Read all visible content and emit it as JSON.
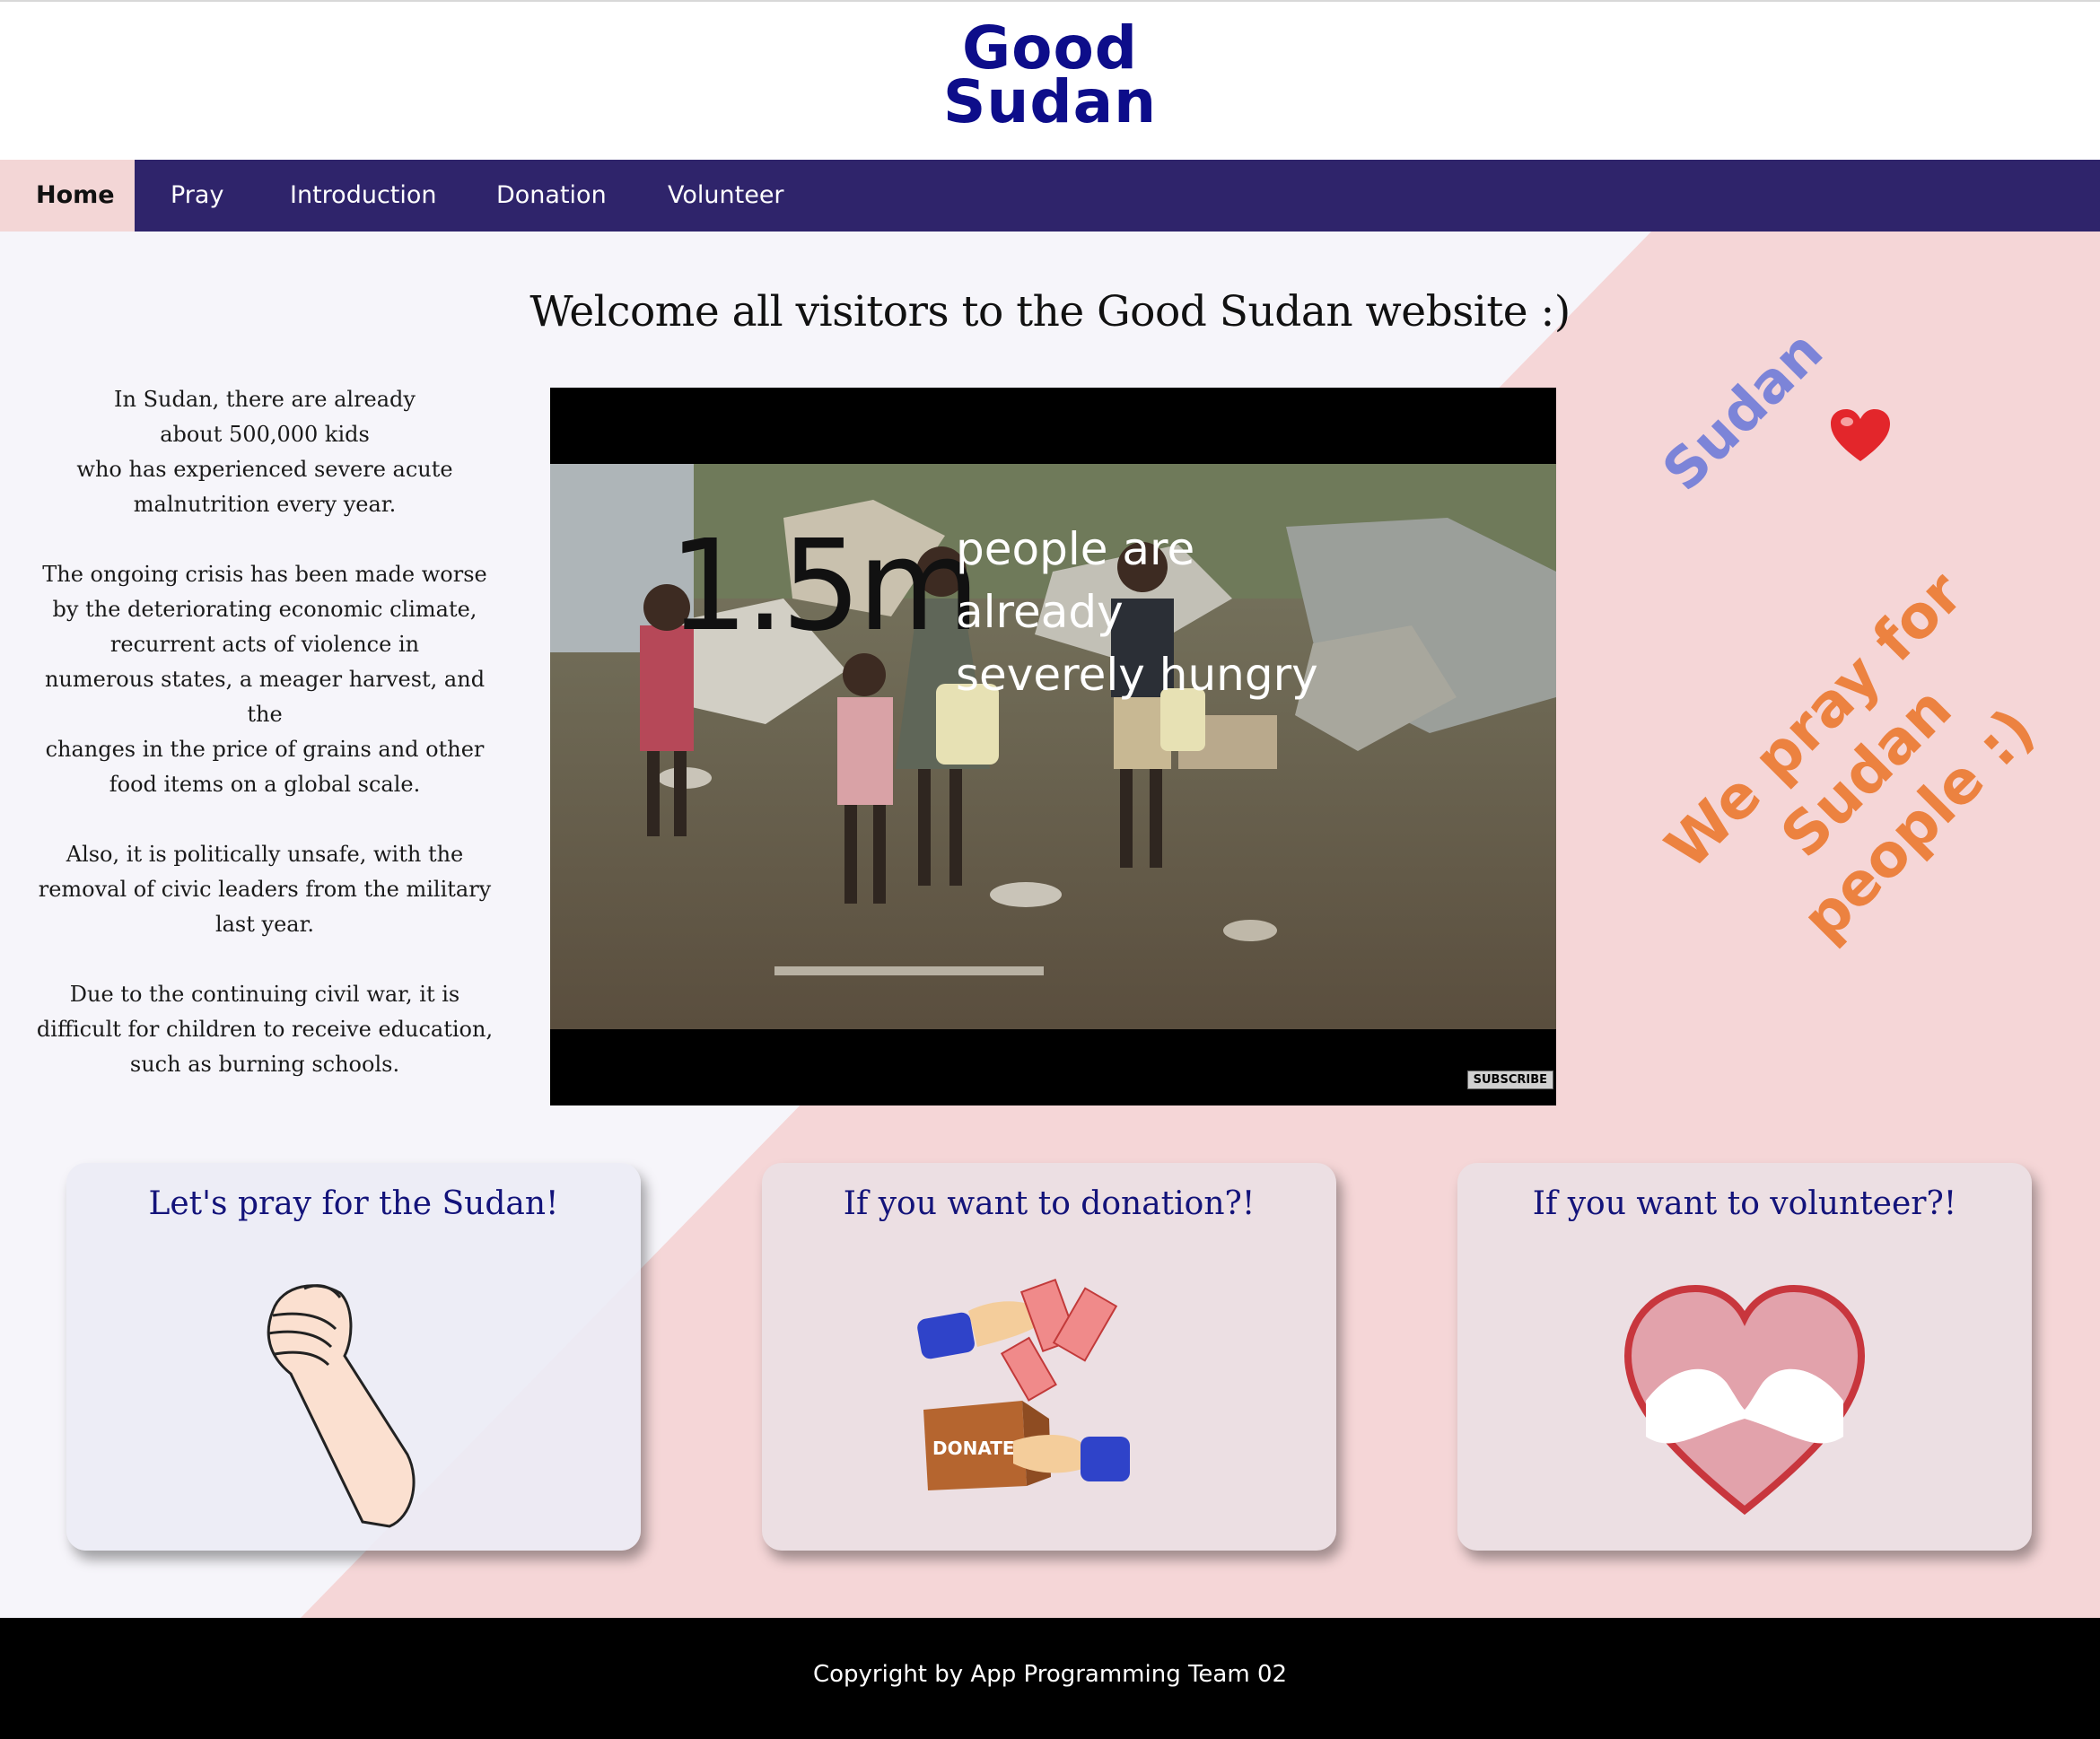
{
  "brand": {
    "logo_line1": "Good",
    "logo_line2": "Sudan"
  },
  "nav": {
    "items": [
      {
        "label": "Home",
        "active": true
      },
      {
        "label": "Pray"
      },
      {
        "label": "Introduction"
      },
      {
        "label": "Donation"
      },
      {
        "label": "Volunteer"
      }
    ]
  },
  "main": {
    "welcome": "Welcome all visitors to the Good Sudan website :)",
    "facts": [
      "In Sudan, there are already\nabout 500,000 kids\nwho has experienced severe acute\nmalnutrition every year.",
      "The ongoing crisis has been made worse\nby the deteriorating economic climate,\nrecurrent acts of violence in\nnumerous states, a meager harvest, and the\nchanges in the price of grains and other\nfood items on a global scale.",
      "Also, it is politically unsafe, with the\nremoval of civic leaders from the military\nlast year.",
      "Due to the continuing civil war, it is\ndifficult for children to receive education,\nsuch as burning schools."
    ],
    "video": {
      "big_number": "1.5m",
      "caption": "people are already\nseverely hungry",
      "subscribe": "SUBSCRIBE"
    },
    "slogan_top": "Sudan",
    "slogan_bottom": "We pray for\nSudan people :)"
  },
  "cards": [
    {
      "title": "Let's pray for the Sudan!",
      "icon": "praying-hands-icon"
    },
    {
      "title": "If you want to donation?!",
      "icon": "donation-box-icon",
      "box_label": "DONATE"
    },
    {
      "title": "If you want to volunteer?!",
      "icon": "heart-hands-icon"
    }
  ],
  "footer": {
    "text": "Copyright by App Programming Team 02"
  },
  "colors": {
    "nav_bg": "#2f246b",
    "active_tab_bg": "#f3d6d6",
    "logo": "#0d0d8a",
    "pink_bg": "#f5d6d7",
    "light_bg": "#f6f5fa",
    "slogan_blue": "#7c84d8",
    "slogan_orange": "#ec8240"
  }
}
